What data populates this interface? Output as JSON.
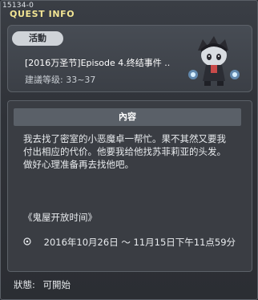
{
  "window": {
    "id": "15134-0",
    "title": "QUEST INFO"
  },
  "quest": {
    "category": "活動",
    "name": "[2016万圣节]Episode 4.终结事件 ..",
    "level": "建議等级: 33~37"
  },
  "content": {
    "header": "內容",
    "description": [
      "我去找了密室的小恶魔卓一帮忙。果不其然又要我",
      "付出相应的代价。他要我给他找苏菲莉亚的头发。",
      "做好心理准备再去找他吧。"
    ],
    "time_title": "《鬼屋开放时间》",
    "time_icon": "clock-icon",
    "time_range": "2016年10月26日 ～ 11月15日下午11点59分"
  },
  "status": {
    "label": "狀態:",
    "value": "可開始"
  },
  "colors": {
    "title": "#f1e493",
    "badge_bg": "#cfd3d8",
    "header_bg": "#5a6068"
  }
}
